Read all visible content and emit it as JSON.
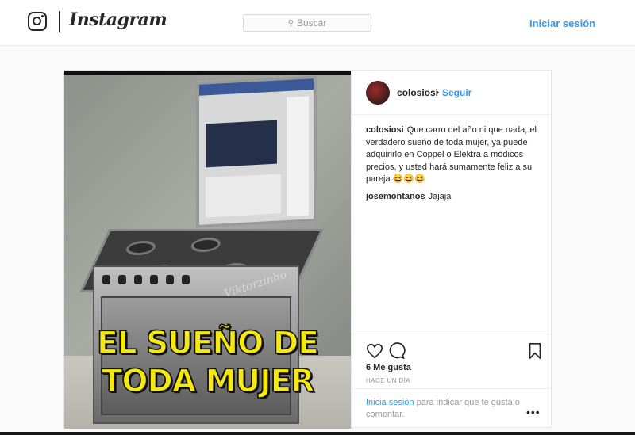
{
  "header": {
    "brand": "Instagram",
    "search_placeholder": "Buscar",
    "login_label": "Iniciar sesión"
  },
  "post": {
    "username": "colosiosi",
    "separator": "•",
    "follow_label": "Seguir",
    "image_caption_line1": "EL SUEÑO DE",
    "image_caption_line2": "TODA MUJER",
    "image_watermark": "Viktorzinho",
    "comments": [
      {
        "user": "colosiosi",
        "text": "Que carro del año ni que nada, el verdadero sueño de toda mujer, ya puede adquirirlo en Coppel o Elektra a módicos precios, y usted hará sumamente feliz a su pareja 😆😆😆"
      },
      {
        "user": "josemontanos",
        "text": "Jajaja"
      }
    ],
    "likes": "6 Me gusta",
    "time": "HACE UN DÍA",
    "login_prompt_link": "Inicia sesión",
    "login_prompt_text": " para indicar que te gusta o comentar."
  },
  "colors": {
    "link_blue": "#3897f0",
    "caption_yellow": "#f5e90f"
  },
  "icons": [
    "instagram-glyph-icon",
    "search-icon",
    "heart-icon",
    "comment-icon",
    "bookmark-icon",
    "more-options-icon"
  ]
}
